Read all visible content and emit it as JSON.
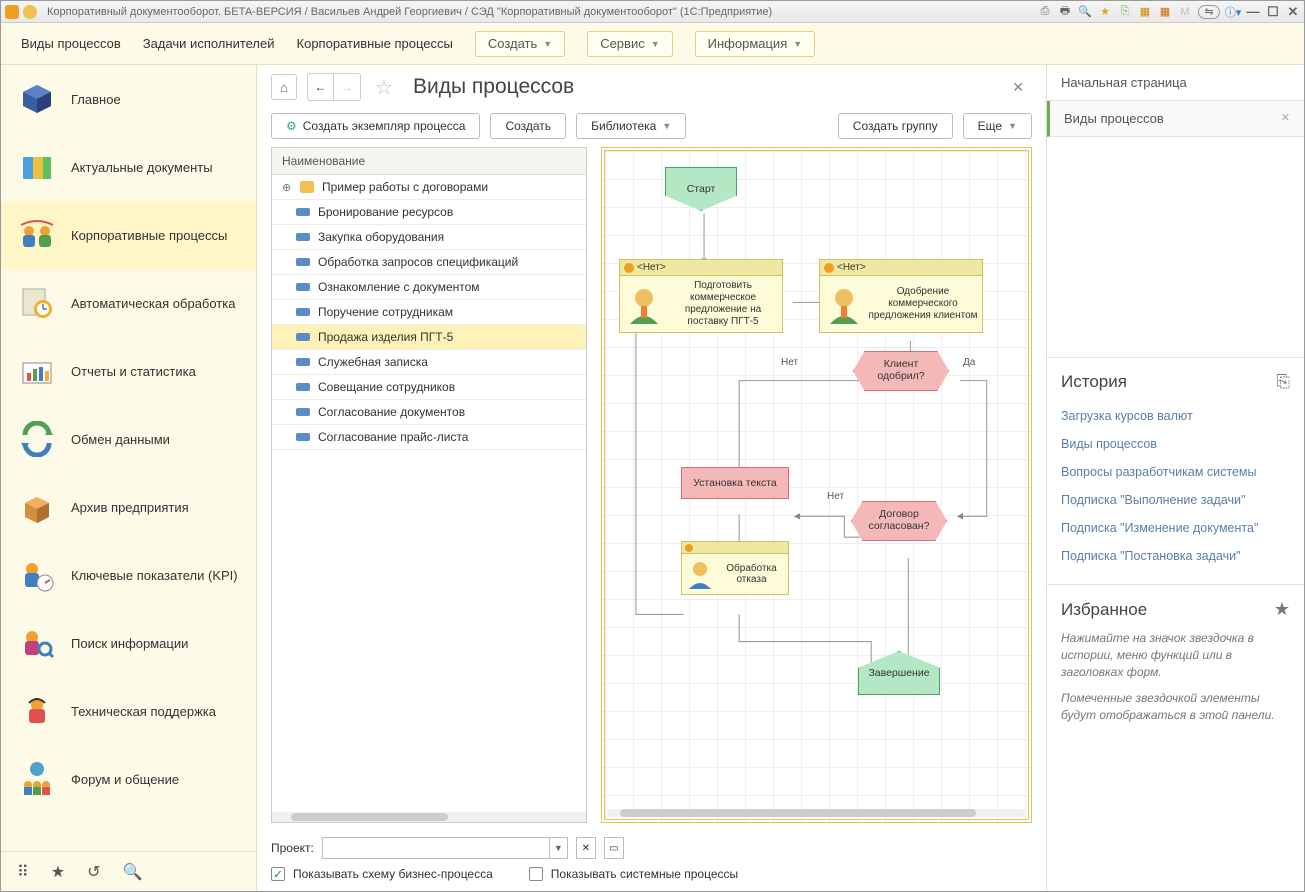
{
  "titlebar": {
    "text": "Корпоративный документооборот. БЕТА-ВЕРСИЯ / Васильев Андрей Георгиевич / СЭД \"Корпоративный документооборот\"  (1С:Предприятие)"
  },
  "topmenu": {
    "items": [
      "Виды процессов",
      "Задачи исполнителей",
      "Корпоративные процессы"
    ],
    "buttons": {
      "create": "Создать",
      "service": "Сервис",
      "info": "Информация"
    }
  },
  "sidebar": {
    "items": [
      {
        "label": "Главное"
      },
      {
        "label": "Актуальные документы"
      },
      {
        "label": "Корпоративные процессы"
      },
      {
        "label": "Автоматическая обработка"
      },
      {
        "label": "Отчеты и статистика"
      },
      {
        "label": "Обмен данными"
      },
      {
        "label": "Архив предприятия"
      },
      {
        "label": "Ключевые показатели (KPI)"
      },
      {
        "label": "Поиск информации"
      },
      {
        "label": "Техническая поддержка"
      },
      {
        "label": "Форум и общение"
      }
    ]
  },
  "page": {
    "title": "Виды процессов"
  },
  "toolbar": {
    "create_instance": "Создать экземпляр процесса",
    "create": "Создать",
    "library": "Библиотека",
    "create_group": "Создать группу",
    "more": "Еще"
  },
  "tree": {
    "header": "Наименование",
    "folder": "Пример работы с договорами",
    "items": [
      "Бронирование ресурсов",
      "Закупка оборудования",
      "Обработка запросов спецификаций",
      "Ознакомление с документом",
      "Поручение сотрудникам",
      "Продажа изделия ПГТ-5",
      "Служебная записка",
      "Совещание сотрудников",
      "Согласование документов",
      "Согласование прайс-листа"
    ],
    "selected_index": 5
  },
  "diagram": {
    "start": "Старт",
    "task1_role": "<Нет>",
    "task1_text": "Подготовить коммерческое предложение на поставку ПГТ-5",
    "task2_role": "<Нет>",
    "task2_text": "Одобрение коммерческого предложения клиентом",
    "gate1": "Клиент одобрил?",
    "box": "Установка текста",
    "gate2": "Договор согласован?",
    "task3": "Обработка отказа",
    "end": "Завершение",
    "label_no": "Нет",
    "label_yes": "Да",
    "label_no2": "Нет"
  },
  "footer": {
    "project_label": "Проект:",
    "show_schema": "Показывать схему бизнес-процесса",
    "show_system": "Показывать системные процессы"
  },
  "rightpanel": {
    "tab_home": "Начальная страница",
    "tab_active": "Виды процессов",
    "history_title": "История",
    "history_items": [
      "Загрузка курсов валют",
      "Виды процессов",
      "Вопросы разработчикам системы",
      "Подписка \"Выполнение задачи\"",
      "Подписка \"Изменение документа\"",
      "Подписка \"Постановка задачи\""
    ],
    "fav_title": "Избранное",
    "fav_hint1": "Нажимайте на значок звездочка в истории, меню функций или в заголовках форм.",
    "fav_hint2": "Помеченные звездочкой элементы будут отображаться в этой панели."
  }
}
